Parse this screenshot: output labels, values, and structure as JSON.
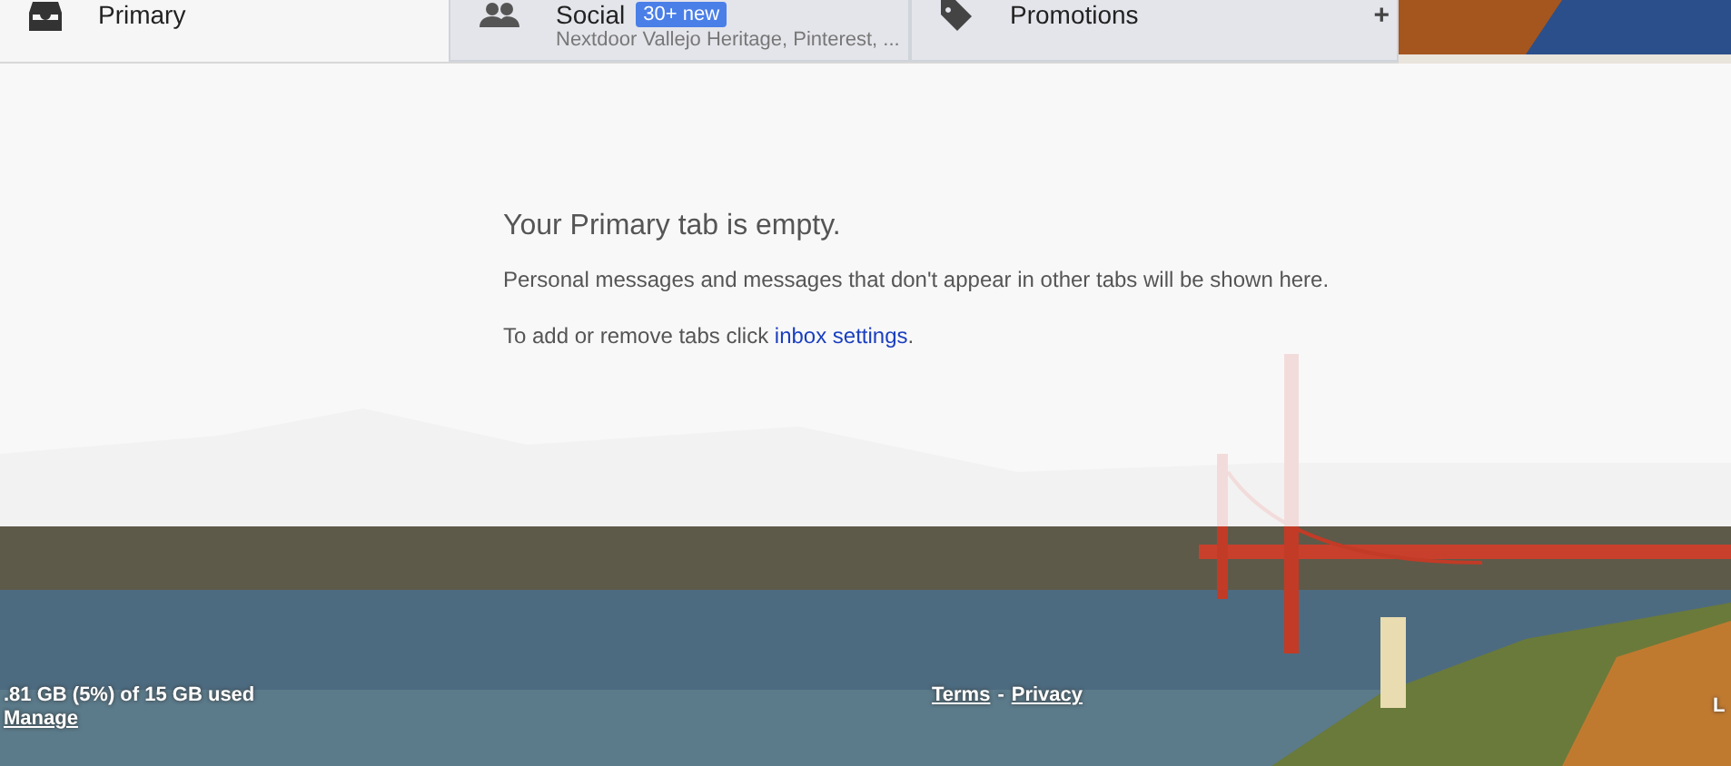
{
  "tabs": [
    {
      "kind": "inbox",
      "label": "Primary",
      "selected": true
    },
    {
      "kind": "people",
      "label": "Social",
      "badge": "30+ new",
      "subtitle": "Nextdoor Vallejo Heritage, Pinterest, ...",
      "selected": false
    },
    {
      "kind": "tag",
      "label": "Promotions",
      "selected": false
    }
  ],
  "add_tab": "+",
  "empty_state": {
    "title": "Your Primary tab is empty.",
    "message": "Personal messages and messages that don't appear in other tabs will be shown here.",
    "hint": "To add or remove tabs click ",
    "hint_link": "inbox settings",
    "hint_end": "."
  },
  "footer": {
    "storage": ".81 GB (5%) of 15 GB used",
    "manage": "Manage",
    "terms": "Terms",
    "separator": "-",
    "privacy": "Privacy",
    "right_text": "L"
  }
}
